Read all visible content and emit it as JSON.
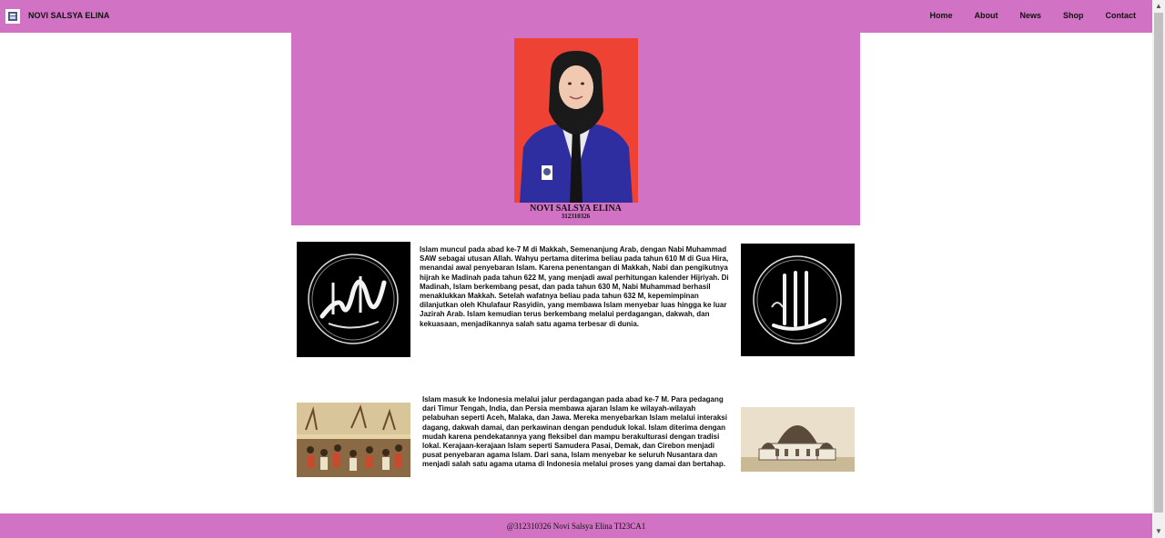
{
  "navbar": {
    "brand": "NOVI SALSYA ELINA",
    "logo_icon": "campus-logo-icon",
    "links": [
      "Home",
      "About",
      "News",
      "Shop",
      "Contact"
    ]
  },
  "hero": {
    "name": "NOVI SALSYA ELINA",
    "nim": "312310326"
  },
  "sections": [
    {
      "text": "Islam muncul pada abad ke-7 M di Makkah, Semenanjung Arab, dengan Nabi Muhammad SAW sebagai utusan Allah. Wahyu pertama diterima beliau pada tahun 610 M di Gua Hira, menandai awal penyebaran Islam. Karena penentangan di Makkah, Nabi dan pengikutnya hijrah ke Madinah pada tahun 622 M, yang menjadi awal perhitungan kalender Hijriyah. Di Madinah, Islam berkembang pesat, dan pada tahun 630 M, Nabi Muhammad berhasil menaklukkan Makkah. Setelah wafatnya beliau pada tahun 632 M, kepemimpinan dilanjutkan oleh Khulafaur Rasyidin, yang membawa Islam menyebar luas hingga ke luar Jazirah Arab. Islam kemudian terus berkembang melalui perdagangan, dakwah, dan kekuasaan, menjadikannya salah satu agama terbesar di dunia."
    },
    {
      "text": "Islam masuk ke Indonesia melalui jalur perdagangan pada abad ke-7 M. Para pedagang dari Timur Tengah, India, dan Persia membawa ajaran Islam ke wilayah-wilayah pelabuhan seperti Aceh, Malaka, dan Jawa. Mereka menyebarkan Islam melalui interaksi dagang, dakwah damai, dan perkawinan dengan penduduk lokal. Islam diterima dengan mudah karena pendekatannya yang fleksibel dan mampu berakulturasi dengan tradisi lokal. Kerajaan-kerajaan Islam seperti Samudera Pasai, Demak, dan Cirebon menjadi pusat penyebaran agama Islam. Dari sana, Islam menyebar ke seluruh Nusantara dan menjadi salah satu agama utama di Indonesia melalui proses yang damai dan bertahap."
    }
  ],
  "footer": {
    "text": "@312310326 Novi Salsya Elina TI23CA1"
  },
  "colors": {
    "accent": "#d272c4",
    "photo_bg": "#ee4234",
    "blazer": "#2f2ea0"
  }
}
